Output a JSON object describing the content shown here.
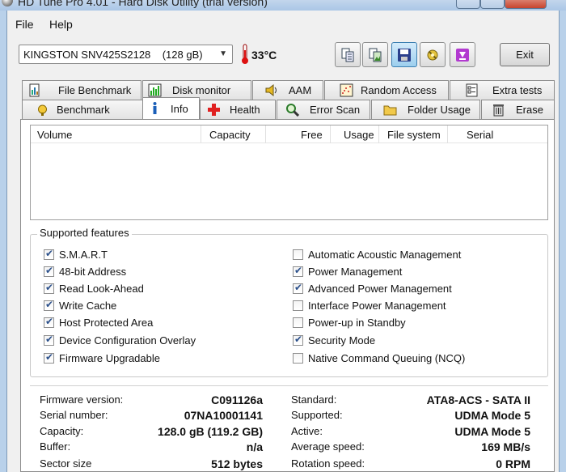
{
  "window": {
    "title": "HD Tune Pro 4.01 - Hard Disk Utility (trial version)"
  },
  "menu": {
    "file": "File",
    "help": "Help"
  },
  "toolbar": {
    "drive": "KINGSTON SNV425S2128    (128 gB)",
    "temperature": "33°C",
    "exit": "Exit"
  },
  "tabs_row1": [
    {
      "label": "File Benchmark",
      "icon": "file-benchmark-icon"
    },
    {
      "label": "Disk monitor",
      "icon": "disk-monitor-icon"
    },
    {
      "label": "AAM",
      "icon": "speaker-icon"
    },
    {
      "label": "Random Access",
      "icon": "random-access-icon"
    },
    {
      "label": "Extra tests",
      "icon": "extra-tests-icon"
    }
  ],
  "tabs_row2": [
    {
      "label": "Benchmark",
      "icon": "benchmark-icon"
    },
    {
      "label": "Info",
      "icon": "info-icon",
      "selected": true
    },
    {
      "label": "Health",
      "icon": "health-cross-icon"
    },
    {
      "label": "Error Scan",
      "icon": "magnifier-icon"
    },
    {
      "label": "Folder Usage",
      "icon": "folder-icon"
    },
    {
      "label": "Erase",
      "icon": "trash-icon"
    }
  ],
  "volumes": {
    "columns": [
      "Volume",
      "Capacity",
      "Free",
      "Usage",
      "File system",
      "Serial"
    ],
    "rows": []
  },
  "features": {
    "title": "Supported features",
    "left": [
      {
        "label": "S.M.A.R.T",
        "checked": true
      },
      {
        "label": "48-bit Address",
        "checked": true
      },
      {
        "label": "Read Look-Ahead",
        "checked": true
      },
      {
        "label": "Write Cache",
        "checked": true
      },
      {
        "label": "Host Protected Area",
        "checked": true
      },
      {
        "label": "Device Configuration Overlay",
        "checked": true
      },
      {
        "label": "Firmware Upgradable",
        "checked": true
      }
    ],
    "right": [
      {
        "label": "Automatic Acoustic Management",
        "checked": false
      },
      {
        "label": "Power Management",
        "checked": true
      },
      {
        "label": "Advanced Power Management",
        "checked": true
      },
      {
        "label": "Interface Power Management",
        "checked": false
      },
      {
        "label": "Power-up in Standby",
        "checked": false
      },
      {
        "label": "Security Mode",
        "checked": true
      },
      {
        "label": "Native Command Queuing (NCQ)",
        "checked": false
      }
    ]
  },
  "details": {
    "left": [
      {
        "label": "Firmware version:",
        "value": "C091126a"
      },
      {
        "label": "Serial number:",
        "value": "07NA10001141"
      },
      {
        "label": "Capacity:",
        "value": "128.0 gB (119.2 GB)"
      },
      {
        "label": "Buffer:",
        "value": "n/a"
      },
      {
        "label": "Sector size",
        "value": "512 bytes"
      }
    ],
    "right": [
      {
        "label": "Standard:",
        "value": "ATA8-ACS - SATA II"
      },
      {
        "label": "Supported:",
        "value": "UDMA Mode 5"
      },
      {
        "label": "Active:",
        "value": "UDMA Mode 5"
      },
      {
        "label": "Average speed:",
        "value": "169 MB/s"
      },
      {
        "label": "Rotation speed:",
        "value": "0 RPM"
      }
    ]
  }
}
